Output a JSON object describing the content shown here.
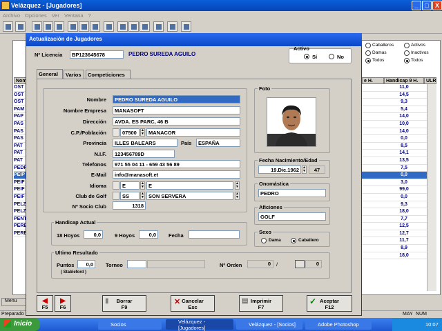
{
  "window": {
    "title": "Velázquez - [Jugadores]",
    "min": "_",
    "max": "□",
    "close": "X"
  },
  "menu": [
    "Archivo",
    "Opciones",
    "Ver",
    "Ventana",
    "?"
  ],
  "background": {
    "right_options": [
      {
        "label": "Caballeros",
        "checked": false
      },
      {
        "label": "Activos",
        "checked": false
      },
      {
        "label": "Damas",
        "checked": false
      },
      {
        "label": "Inactivos",
        "checked": false
      },
      {
        "label": "Todos",
        "checked": true
      },
      {
        "label": "Todos",
        "checked": true
      }
    ],
    "col_nom": "Nom",
    "col_h": "e H.",
    "col_handicap": "Handicap 9 H.",
    "col_ult": "ULR",
    "left_rows": [
      "OST",
      "OST",
      "OST",
      "PAM",
      "PAP",
      "PAS",
      "PAS",
      "PAS",
      "PAT",
      "PAT",
      "PAT",
      "PEDR",
      "PEIP",
      "PEIF",
      "PEIF",
      "PEIF",
      "PELZ",
      "PELZ",
      "PENT",
      "PERE",
      "PERE"
    ],
    "handicaps": [
      "11,0",
      "14,5",
      "9,3",
      "5,4",
      "14,0",
      "10,0",
      "14,0",
      "0,0",
      "8,5",
      "14,1",
      "13,5",
      "7,5",
      "0,0",
      "3,0",
      "99,0",
      "0,0",
      "9,3",
      "18,0",
      "7,7",
      "12,5",
      "12,7",
      "11,7",
      "8,9",
      "18,0"
    ],
    "selected_index": 12,
    "status": [
      "Preparado",
      "MAY",
      "NUM"
    ],
    "side_tab": "Menu"
  },
  "dialog": {
    "title": "Actualización de Jugadores",
    "licencia_label": "Nº Licencia",
    "licencia": "BP123645678",
    "player_name": "PEDRO SUREDA AGUILO",
    "activo_title": "Activo",
    "si": "Sí",
    "no": "No",
    "tabs": [
      "General",
      "Varios",
      "Competiciones"
    ],
    "fields": {
      "nombre_label": "Nombre",
      "nombre": "PEDRO SUREDA AGUILO",
      "empresa_label": "Nombre Empresa",
      "empresa": "MANASOFT",
      "direccion_label": "Dirección",
      "direccion": "AVDA. ES PARC, 46 B",
      "cp_label": "C.P./Población",
      "cp": "07500",
      "poblacion": "MANACOR",
      "provincia_label": "Provincia",
      "provincia": "ILLES BALEARS",
      "pais_label": "País",
      "pais": "ESPAÑA",
      "nif_label": "N.I.F.",
      "nif": "123456789D",
      "telefonos_label": "Telefonos",
      "telefonos": "971 55 04 11 - 659 43 56 89",
      "email_label": "E-Mail",
      "email": "info@manasoft.et",
      "idioma_label": "Idioma",
      "idioma_code": "E",
      "idioma": "E",
      "club_label": "Club de Golf",
      "club_code": "SS",
      "club": "SON SERVERA",
      "socio_label": "Nº Socio Club",
      "socio": "1318"
    },
    "foto_title": "Foto",
    "nacimiento_title": "Fecha Nacimiento/Edad",
    "nacimiento": "19.Dic.1962",
    "edad": "47",
    "onomastica_title": "Onomástica",
    "onomastica": "PEDRO",
    "aficiones_title": "Aficiones",
    "aficiones": "GOLF",
    "sexo_title": "Sexo",
    "dama": "Dama",
    "caballero": "Caballero",
    "handicap_title": "Handicap Actual",
    "h18_label": "18 Hoyos",
    "h18": "0,0",
    "h9_label": "9 Hoyos",
    "h9": "0,0",
    "fecha_label": "Fecha",
    "resultado_title": "Ultimo Resultado",
    "puntos_label": "Puntos",
    "puntos": "0,0",
    "stableford": "( Stableford )",
    "torneo_label": "Torneo",
    "orden_label": "Nº Orden",
    "orden_a": "0",
    "orden_sep": "/",
    "orden_b": "0",
    "buttons": {
      "prev_key": "F5",
      "next_key": "F6",
      "borrar": "Borrar",
      "borrar_key": "F9",
      "cancelar": "Cancelar",
      "cancelar_key": "Esc",
      "imprimir": "Imprimir",
      "imprimir_key": "F7",
      "aceptar": "Aceptar",
      "aceptar_key": "F12"
    }
  },
  "taskbar": {
    "start": "Inicio",
    "tasks": [
      "Socios",
      "Velázquez - [Jugadores]",
      "Velázquez - [Socios]",
      "Adobe Photoshop"
    ],
    "clock": "10:07"
  }
}
